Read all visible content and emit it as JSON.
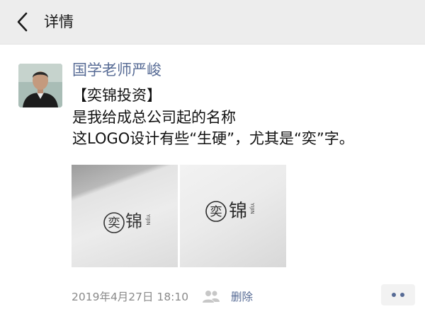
{
  "header": {
    "title": "详情",
    "back_icon": "chevron-left-icon"
  },
  "post": {
    "author": "国学老师严峻",
    "lines": [
      "【奕锦投资】",
      "是我给成总公司起的名称",
      "这LOGO设计有些“生硬”，尤其是“奕”字。"
    ],
    "images": [
      {
        "logo_text": "奕",
        "logo_text2": "锦",
        "small_text": "YIJIN"
      },
      {
        "logo_text": "奕",
        "logo_text2": "锦",
        "small_text": "YIJIN"
      }
    ],
    "timestamp": "2019年4月27日 18:10",
    "delete_label": "删除",
    "more_icon": "more-dots-icon",
    "visibility_icon": "people-icon"
  },
  "colors": {
    "link": "#576b95",
    "header_bg": "#ededed"
  }
}
